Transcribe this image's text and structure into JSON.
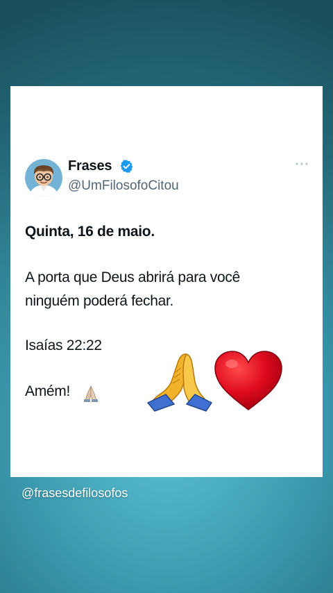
{
  "post": {
    "author": {
      "display_name": "Frases",
      "handle": "@UmFilosofoCitou",
      "verified": true,
      "avatar_icon": "cartoon-philosopher-avatar"
    },
    "more_icon": "more-options-icon",
    "headline": "Quinta, 16 de maio.",
    "body_line_1": "A porta que Deus abrirá para você",
    "body_line_2": "ninguém poderá fechar.",
    "verse": "Isaías 22:22",
    "amen": "Amém!",
    "emojis": [
      "folded-hands-icon",
      "red-heart-icon"
    ]
  },
  "watermark": "@frasesdefilosofos",
  "colors": {
    "verified_blue": "#1d9bf0",
    "text_primary": "#0f1419",
    "text_secondary": "#536471",
    "heart_red": "#d8001c"
  }
}
